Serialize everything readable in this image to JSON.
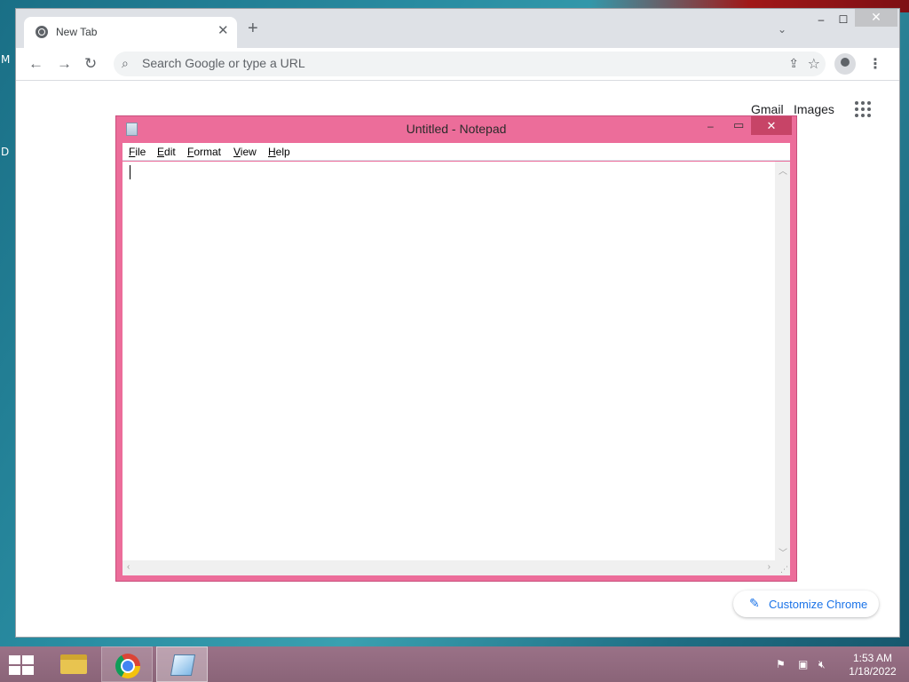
{
  "desktop": {
    "edge_letters": [
      "M",
      "D"
    ]
  },
  "chrome": {
    "tab": {
      "title": "New Tab",
      "close": "✕"
    },
    "new_tab": "+",
    "tab_search": "⌄",
    "window_controls": {
      "minimize": "–",
      "maximize": "☐",
      "close": "✕"
    },
    "nav": {
      "back": "←",
      "forward": "→",
      "reload": "↻"
    },
    "omnibox": {
      "placeholder": "Search Google or type a URL",
      "value": ""
    },
    "ntp": {
      "gmail": "Gmail",
      "images": "Images",
      "customize": "Customize Chrome"
    }
  },
  "notepad": {
    "title": "Untitled - Notepad",
    "controls": {
      "minimize": "–",
      "maximize": "▭",
      "close": "✕"
    },
    "menu": [
      "File",
      "Edit",
      "Format",
      "View",
      "Help"
    ],
    "content": ""
  },
  "taskbar": {
    "apps": [
      "file-explorer",
      "google-chrome",
      "notepad"
    ],
    "clock": {
      "time": "1:53 AM",
      "date": "1/18/2022"
    }
  }
}
